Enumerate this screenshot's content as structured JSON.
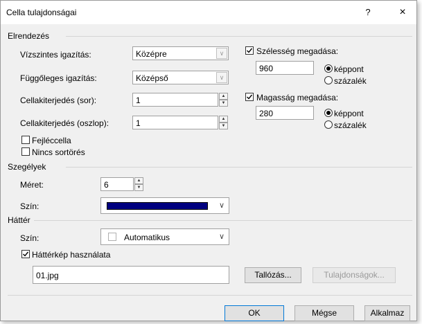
{
  "window": {
    "title": "Cella tulajdonságai",
    "help": "?",
    "close": "×"
  },
  "layout_group": {
    "title": "Elrendezés",
    "horizontal_align": {
      "label": "Vízszintes igazítás:",
      "value": "Középre"
    },
    "vertical_align": {
      "label": "Függőleges igazítás:",
      "value": "Középső"
    },
    "rowspan": {
      "label": "Cellakiterjedés (sor):",
      "value": "1"
    },
    "colspan": {
      "label": "Cellakiterjedés (oszlop):",
      "value": "1"
    },
    "header_cell": {
      "label": "Fejléccella",
      "checked": false
    },
    "no_wrap": {
      "label": "Nincs sortörés",
      "checked": false
    },
    "width": {
      "label": "Szélesség megadása:",
      "checked": true,
      "value": "960",
      "unit_pixel": "képpont",
      "unit_percent": "százalék",
      "selected": "pixel"
    },
    "height": {
      "label": "Magasság megadása:",
      "checked": true,
      "value": "280",
      "unit_pixel": "képpont",
      "unit_percent": "százalék",
      "selected": "pixel"
    }
  },
  "borders_group": {
    "title": "Szegélyek",
    "size": {
      "label": "Méret:",
      "value": "6"
    },
    "color": {
      "label": "Szín:",
      "value_color": "#000080"
    }
  },
  "background_group": {
    "title": "Háttér",
    "color": {
      "label": "Szín:",
      "value": "Automatikus"
    },
    "use_image": {
      "label": "Háttérkép használata",
      "checked": true
    },
    "image_path": "01.jpg",
    "browse": "Tallózás...",
    "properties": "Tulajdonságok..."
  },
  "footer": {
    "ok": "OK",
    "cancel": "Mégse",
    "apply": "Alkalmaz"
  },
  "colors": {
    "dialog_bg": "#f0f0f0",
    "accent": "#0078d7",
    "border_color_swatch": "#000080"
  }
}
